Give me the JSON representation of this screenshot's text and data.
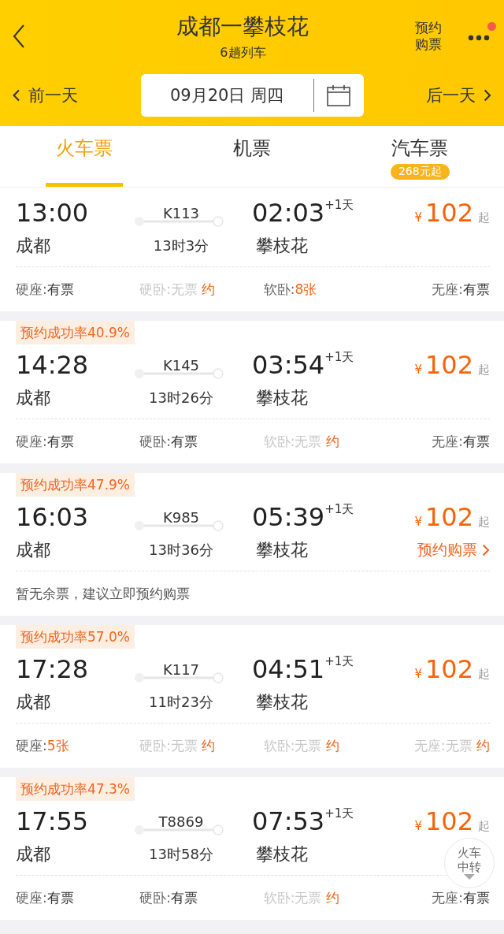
{
  "header": {
    "title": "成都一攀枝花",
    "subtitle": "6趟列车",
    "reserve_button": "预约购票",
    "has_notification": true
  },
  "date_bar": {
    "prev": "前一天",
    "date": "09月20日 周四",
    "next": "后一天"
  },
  "tabs": [
    {
      "label": "火车票",
      "selected": true
    },
    {
      "label": "机票",
      "selected": false
    },
    {
      "label": "汽车票",
      "selected": false,
      "badge": "268元起"
    }
  ],
  "trains": [
    {
      "depart": "13:00",
      "from": "成都",
      "number": "K113",
      "duration": "13时3分",
      "arrive": "02:03",
      "day_offset": "+1天",
      "to": "攀枝花",
      "currency": "¥",
      "price": "102",
      "price_suffix": "起",
      "seats": [
        {
          "label": "硬座:",
          "value": "有票",
          "kind": "available"
        },
        {
          "label": "硬卧:",
          "value": "无票",
          "kind": "sold_out",
          "tag": "约"
        },
        {
          "label": "软卧:",
          "value": "8张",
          "kind": "few"
        },
        {
          "label": "无座:",
          "value": "有票",
          "kind": "available"
        }
      ]
    },
    {
      "rate": "预约成功率40.9%",
      "depart": "14:28",
      "from": "成都",
      "number": "K145",
      "duration": "13时26分",
      "arrive": "03:54",
      "day_offset": "+1天",
      "to": "攀枝花",
      "currency": "¥",
      "price": "102",
      "price_suffix": "起",
      "seats": [
        {
          "label": "硬座:",
          "value": "有票",
          "kind": "available"
        },
        {
          "label": "硬卧:",
          "value": "有票",
          "kind": "available"
        },
        {
          "label": "软卧:",
          "value": "无票",
          "kind": "sold_out",
          "tag": "约"
        },
        {
          "label": "无座:",
          "value": "有票",
          "kind": "available"
        }
      ]
    },
    {
      "rate": "预约成功率47.9%",
      "depart": "16:03",
      "from": "成都",
      "number": "K985",
      "duration": "13时36分",
      "arrive": "05:39",
      "day_offset": "+1天",
      "to": "攀枝花",
      "currency": "¥",
      "price": "102",
      "price_suffix": "起",
      "action": "预约购票",
      "note": "暂无余票，建议立即预约购票"
    },
    {
      "rate": "预约成功率57.0%",
      "depart": "17:28",
      "from": "成都",
      "number": "K117",
      "duration": "11时23分",
      "arrive": "04:51",
      "day_offset": "+1天",
      "to": "攀枝花",
      "currency": "¥",
      "price": "102",
      "price_suffix": "起",
      "seats": [
        {
          "label": "硬座:",
          "value": "5张",
          "kind": "few"
        },
        {
          "label": "硬卧:",
          "value": "无票",
          "kind": "sold_out",
          "tag": "约"
        },
        {
          "label": "软卧:",
          "value": "无票",
          "kind": "sold_out",
          "tag": "约"
        },
        {
          "label": "无座:",
          "value": "无票",
          "kind": "sold_out",
          "tag": "约"
        }
      ]
    },
    {
      "rate": "预约成功率47.3%",
      "depart": "17:55",
      "from": "成都",
      "number": "T8869",
      "duration": "13时58分",
      "arrive": "07:53",
      "day_offset": "+1天",
      "to": "攀枝花",
      "currency": "¥",
      "price": "102",
      "price_suffix": "起",
      "seats": [
        {
          "label": "硬座:",
          "value": "有票",
          "kind": "available"
        },
        {
          "label": "硬卧:",
          "value": "有票",
          "kind": "available"
        },
        {
          "label": "软卧:",
          "value": "无票",
          "kind": "sold_out",
          "tag": "约"
        },
        {
          "label": "无座:",
          "value": "有票",
          "kind": "available"
        }
      ]
    }
  ],
  "float_button": "火车中转"
}
